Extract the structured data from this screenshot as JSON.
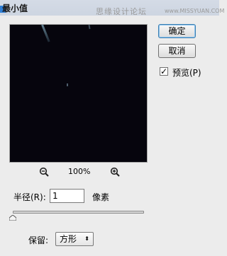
{
  "window": {
    "title": "最小值",
    "watermark": "思缘设计论坛",
    "watermark_url": "www.MISSYUAN.COM"
  },
  "buttons": {
    "ok_label": "确定",
    "cancel_label": "取消"
  },
  "preview_toggle": {
    "label": "预览(P)",
    "checked": true,
    "check_glyph": "✓"
  },
  "zoom": {
    "level": "100%",
    "out_icon": "zoom-out-icon",
    "in_icon": "zoom-in-icon"
  },
  "radius": {
    "label": "半径(R):",
    "value": "1",
    "unit": "像素",
    "slider_fraction": 0.0
  },
  "preserve": {
    "label": "保留:",
    "selected": "方形",
    "arrow": "⬍"
  },
  "colors": {
    "preview_bg": "#06050d",
    "accent": "#3c7fb1"
  }
}
